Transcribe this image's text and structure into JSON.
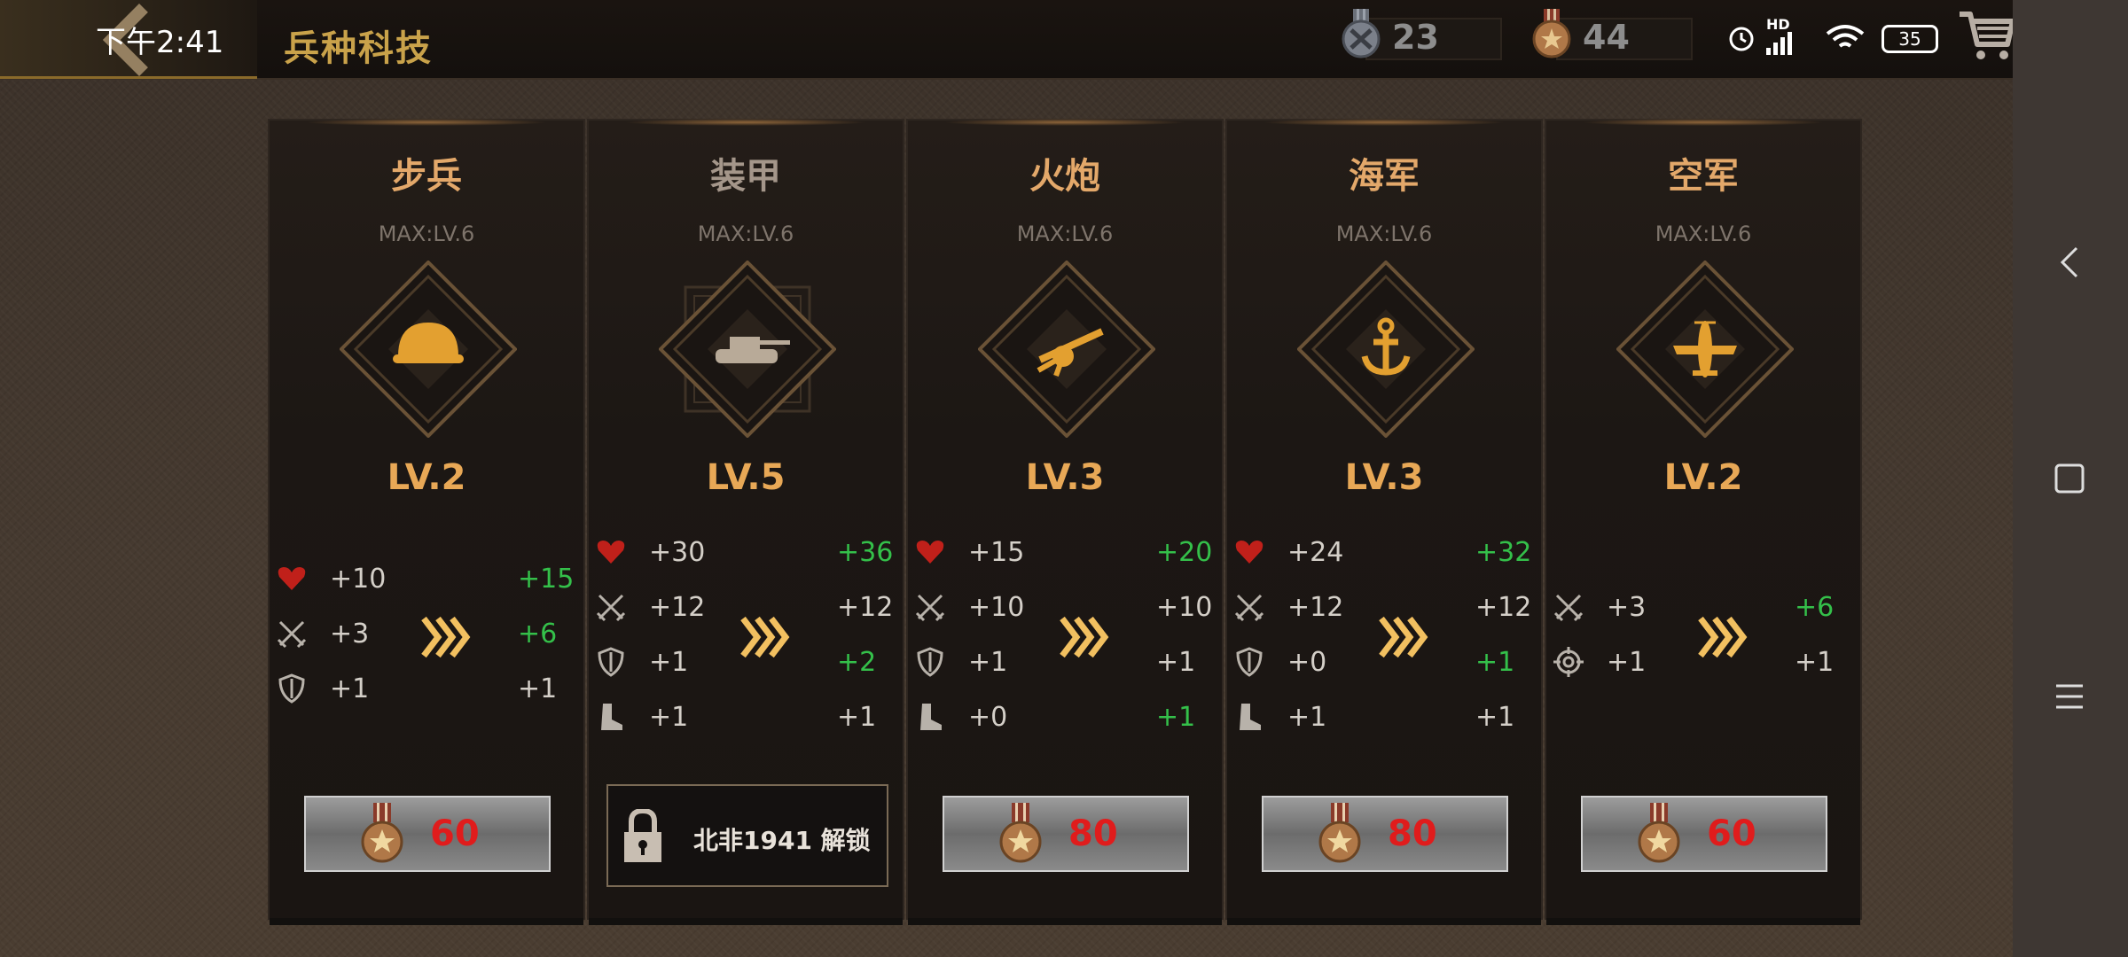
{
  "status_bar": {
    "time": "下午2:41",
    "battery": "35",
    "network": "HD"
  },
  "header": {
    "title": "兵种科技"
  },
  "resources": [
    {
      "icon": "silver-medal-icon",
      "value": "23"
    },
    {
      "icon": "bronze-medal-icon",
      "value": "44"
    }
  ],
  "cards": [
    {
      "name": "步兵",
      "max": "MAX:LV.6",
      "level": "LV.2",
      "icon": "helmet-icon",
      "stats": [
        {
          "icon": "heart-icon",
          "cur": "+10",
          "next": "+15",
          "up": true
        },
        {
          "icon": "swords-icon",
          "cur": "+3",
          "next": "+6",
          "up": true
        },
        {
          "icon": "shield-icon",
          "cur": "+1",
          "next": "+1",
          "up": false
        }
      ],
      "cost": "60",
      "locked": false
    },
    {
      "name": "装甲",
      "max": "MAX:LV.6",
      "level": "LV.5",
      "icon": "tank-icon",
      "stats": [
        {
          "icon": "heart-icon",
          "cur": "+30",
          "next": "+36",
          "up": true
        },
        {
          "icon": "swords-icon",
          "cur": "+12",
          "next": "+12",
          "up": false
        },
        {
          "icon": "shield-icon",
          "cur": "+1",
          "next": "+2",
          "up": true
        },
        {
          "icon": "boot-icon",
          "cur": "+1",
          "next": "+1",
          "up": false
        }
      ],
      "unlock_text": "北非1941 解锁",
      "locked": true
    },
    {
      "name": "火炮",
      "max": "MAX:LV.6",
      "level": "LV.3",
      "icon": "artillery-icon",
      "stats": [
        {
          "icon": "heart-icon",
          "cur": "+15",
          "next": "+20",
          "up": true
        },
        {
          "icon": "swords-icon",
          "cur": "+10",
          "next": "+10",
          "up": false
        },
        {
          "icon": "shield-icon",
          "cur": "+1",
          "next": "+1",
          "up": false
        },
        {
          "icon": "boot-icon",
          "cur": "+0",
          "next": "+1",
          "up": true
        }
      ],
      "cost": "80",
      "locked": false
    },
    {
      "name": "海军",
      "max": "MAX:LV.6",
      "level": "LV.3",
      "icon": "anchor-icon",
      "stats": [
        {
          "icon": "heart-icon",
          "cur": "+24",
          "next": "+32",
          "up": true
        },
        {
          "icon": "swords-icon",
          "cur": "+12",
          "next": "+12",
          "up": false
        },
        {
          "icon": "shield-icon",
          "cur": "+0",
          "next": "+1",
          "up": true
        },
        {
          "icon": "boot-icon",
          "cur": "+1",
          "next": "+1",
          "up": false
        }
      ],
      "cost": "80",
      "locked": false
    },
    {
      "name": "空军",
      "max": "MAX:LV.6",
      "level": "LV.2",
      "icon": "plane-icon",
      "stats": [
        {
          "icon": "swords-icon",
          "cur": "+3",
          "next": "+6",
          "up": true
        },
        {
          "icon": "crosshair-icon",
          "cur": "+1",
          "next": "+1",
          "up": false
        }
      ],
      "cost": "60",
      "locked": false
    }
  ],
  "colors": {
    "accent": "#e8a856",
    "cost": "#e01c1c",
    "up": "#34c04a"
  }
}
